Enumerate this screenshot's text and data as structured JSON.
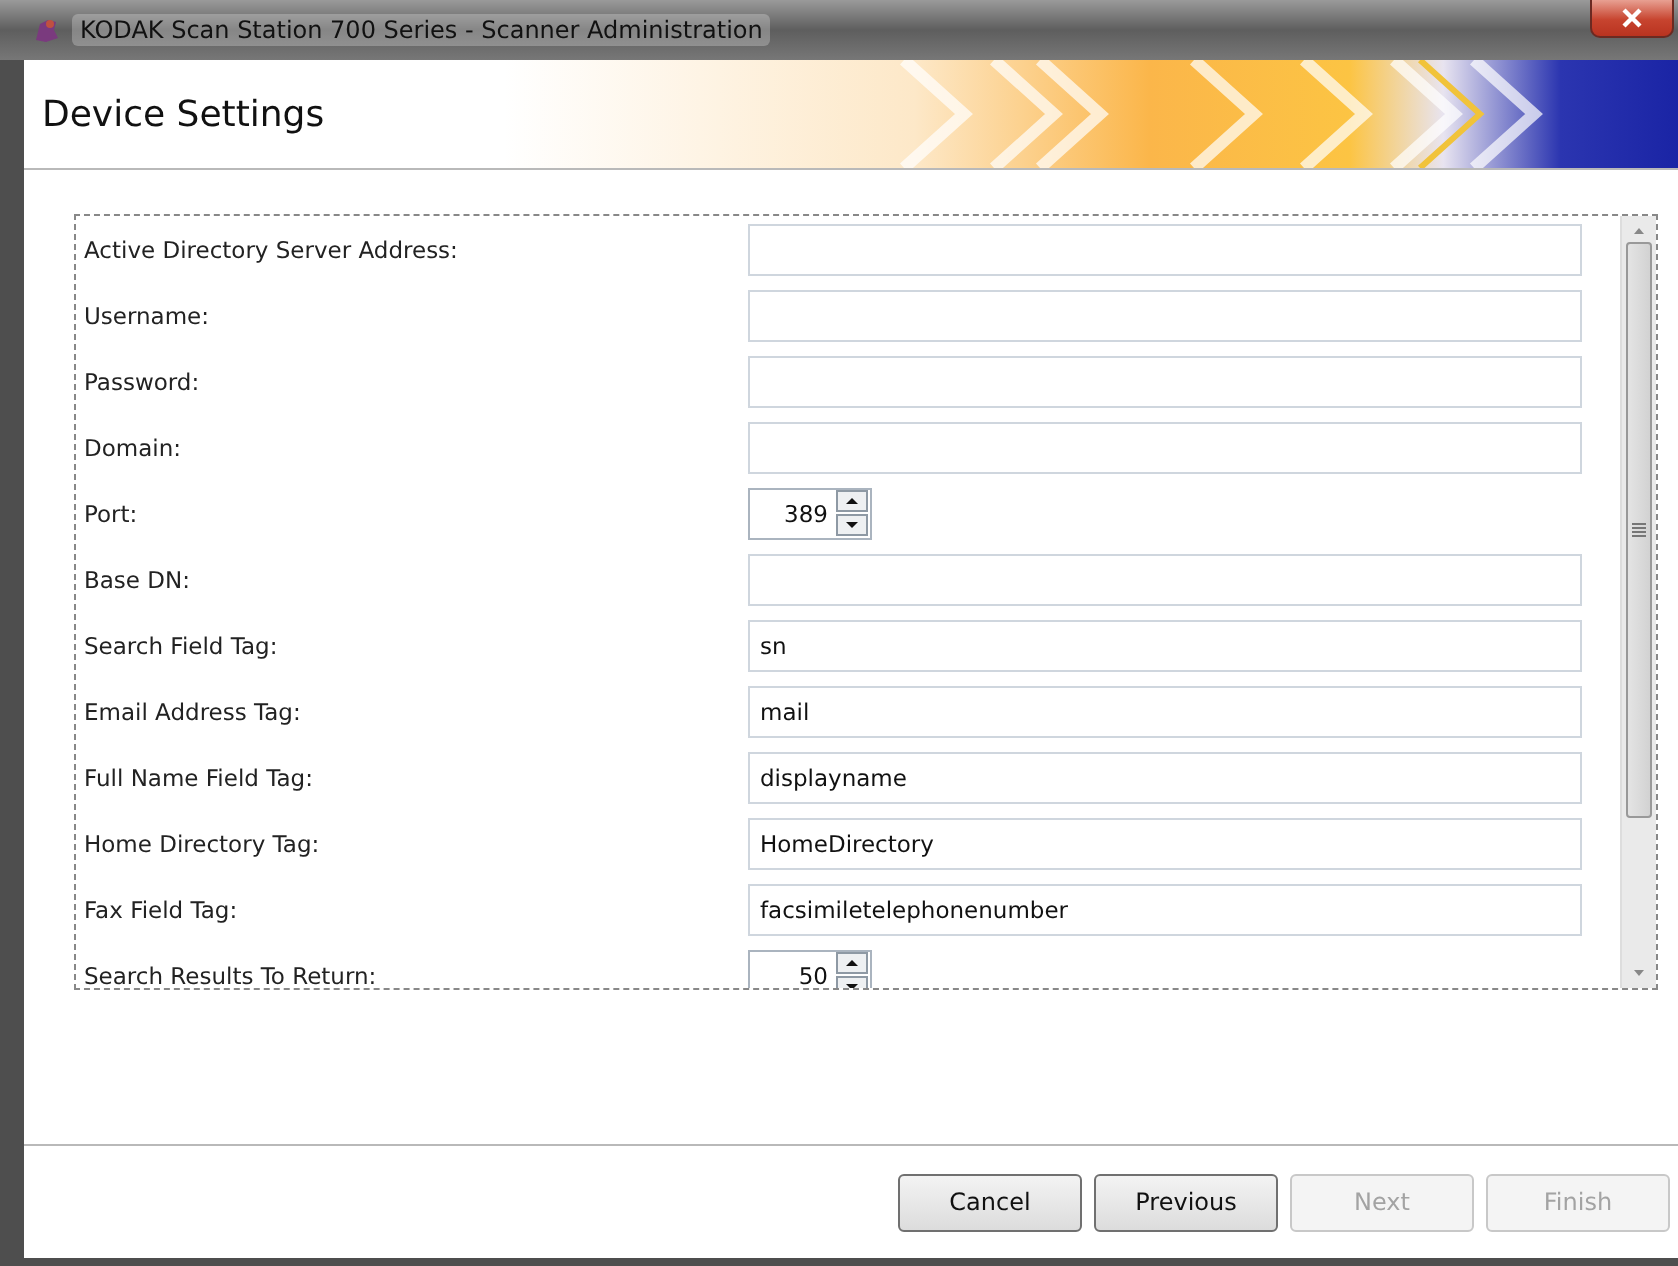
{
  "window": {
    "title": "KODAK Scan Station 700 Series - Scanner Administration"
  },
  "header": {
    "title": "Device Settings"
  },
  "fields": [
    {
      "label": "Active Directory Server Address:",
      "kind": "text"
    },
    {
      "label": "Username:",
      "kind": "text"
    },
    {
      "label": "Password:",
      "kind": "text"
    },
    {
      "label": "Domain:",
      "kind": "text"
    },
    {
      "label": "Port:",
      "kind": "spinner",
      "value": "389"
    },
    {
      "label": "Base DN:",
      "kind": "text"
    },
    {
      "label": "Search Field Tag:",
      "kind": "text",
      "value": "sn"
    },
    {
      "label": "Email Address Tag:",
      "kind": "text",
      "value": "mail"
    },
    {
      "label": "Full Name Field Tag:",
      "kind": "text",
      "value": "displayname"
    },
    {
      "label": "Home Directory Tag:",
      "kind": "text",
      "value": "HomeDirectory"
    },
    {
      "label": "Fax Field Tag:",
      "kind": "text",
      "value": "facsimiletelephonenumber"
    },
    {
      "label": "Search Results To Return:",
      "kind": "spinner",
      "value": "50"
    }
  ],
  "buttons": [
    {
      "label": "Cancel",
      "disabled": false
    },
    {
      "label": "Previous",
      "disabled": false
    },
    {
      "label": "Next",
      "disabled": true
    },
    {
      "label": "Finish",
      "disabled": true
    }
  ]
}
